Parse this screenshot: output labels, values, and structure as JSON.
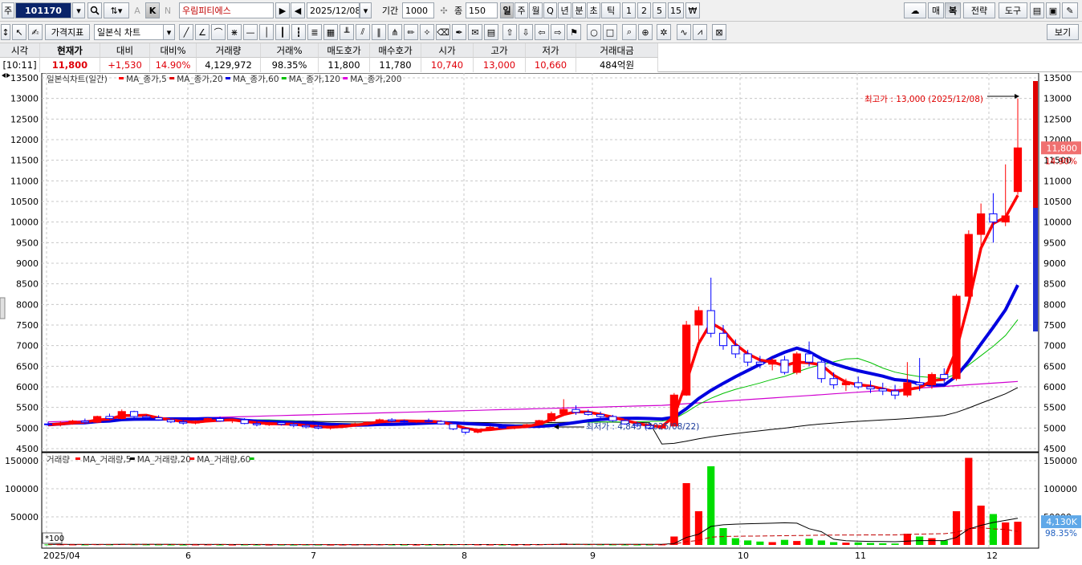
{
  "toolbar1": {
    "type_label": "주",
    "code_value": "101170",
    "stock_name": "우림피티에스",
    "date_value": "2025/12/08",
    "period_label": "기간",
    "period_value": "1000",
    "count_label": "종",
    "count_value": "150",
    "k_label": "K",
    "n_label": "N",
    "a_label": "A",
    "timeframes": [
      "일",
      "주",
      "월",
      "Q",
      "년",
      "분",
      "초",
      "틱",
      "1",
      "2",
      "5",
      "15"
    ],
    "active_timeframe": "일",
    "right_buttons": [
      "매",
      "복",
      "전략",
      "도구"
    ]
  },
  "toolbar2": {
    "indicator_button": "가격지표",
    "chart_type_value": "일본식 차트",
    "view_button": "보기"
  },
  "quote": {
    "headers": [
      "시각",
      "현재가",
      "대비",
      "대비%",
      "거래량",
      "거래%",
      "매도호가",
      "매수호가",
      "시가",
      "고가",
      "저가",
      "거래대금"
    ],
    "values": [
      "[10:11]",
      "11,800",
      "+1,530",
      "14.90%",
      "4,129,972",
      "98.35%",
      "11,800",
      "11,780",
      "10,740",
      "13,000",
      "10,660",
      "484억원"
    ]
  },
  "price_legend": {
    "title": "일본식차트(일간)",
    "items": [
      {
        "label": "MA_종가,5",
        "color": "#ff0000"
      },
      {
        "label": "MA_종가,20",
        "color": "#e00000"
      },
      {
        "label": "MA_종가,60",
        "color": "#0000e0"
      },
      {
        "label": "MA_종가,120",
        "color": "#00c000"
      },
      {
        "label": "MA_종가,200",
        "color": "#e000e0"
      }
    ]
  },
  "volume_legend": {
    "title": "거래량",
    "items": [
      {
        "label": "MA_거래량,5",
        "color": "#ff0000"
      },
      {
        "label": "MA_거래량,20",
        "color": "#000000"
      },
      {
        "label": "MA_거래량,60",
        "color": "#ff0000"
      }
    ],
    "tail_color": "#00c000"
  },
  "annotations": {
    "high_label": "최고가 : 13,000 (2025/12/08)",
    "low_label": "최저가 : 4,845 (2025/08/22)",
    "current_price_tag": "11,800",
    "current_pct_tag": "14.90%",
    "volume_tag": "4,130K",
    "volume_pct_tag": "98.35%",
    "volume_unit": "*100"
  },
  "colors": {
    "up": "#ff0000",
    "down": "#0000ff",
    "ma5": "#ff0000",
    "ma20": "#0000e0",
    "ma60": "#00c000",
    "ma120": "#000000",
    "ma200": "#d000d0"
  },
  "chart_data": {
    "type": "candlestick",
    "price_axis": {
      "min": 4500,
      "max": 13500,
      "ticks": [
        4500,
        5000,
        5500,
        6000,
        6500,
        7000,
        7500,
        8000,
        8500,
        9000,
        9500,
        10000,
        10500,
        11000,
        11500,
        12000,
        12500,
        13000,
        13500
      ]
    },
    "volume_axis": {
      "min": 0,
      "max": 150000,
      "ticks": [
        50000,
        100000,
        150000
      ]
    },
    "x_ticks": [
      "2025/04",
      "6",
      "7",
      "8",
      "9",
      "10",
      "11",
      "12"
    ],
    "grid": true,
    "ohlc": [
      [
        5100,
        5150,
        5050,
        5080
      ],
      [
        5080,
        5160,
        5040,
        5120
      ],
      [
        5120,
        5200,
        5080,
        5170
      ],
      [
        5170,
        5230,
        5100,
        5140
      ],
      [
        5140,
        5300,
        5120,
        5280
      ],
      [
        5280,
        5350,
        5200,
        5230
      ],
      [
        5230,
        5450,
        5210,
        5400
      ],
      [
        5400,
        5420,
        5250,
        5280
      ],
      [
        5280,
        5320,
        5200,
        5250
      ],
      [
        5250,
        5310,
        5180,
        5200
      ],
      [
        5200,
        5260,
        5120,
        5150
      ],
      [
        5150,
        5200,
        5080,
        5120
      ],
      [
        5120,
        5190,
        5090,
        5160
      ],
      [
        5160,
        5250,
        5140,
        5230
      ],
      [
        5230,
        5280,
        5150,
        5170
      ],
      [
        5170,
        5230,
        5120,
        5200
      ],
      [
        5200,
        5240,
        5090,
        5110
      ],
      [
        5110,
        5160,
        5040,
        5080
      ],
      [
        5080,
        5150,
        5050,
        5130
      ],
      [
        5130,
        5170,
        5060,
        5090
      ],
      [
        5090,
        5140,
        5020,
        5060
      ],
      [
        5060,
        5110,
        4990,
        5030
      ],
      [
        5030,
        5080,
        4970,
        5000
      ],
      [
        5000,
        5060,
        4960,
        5040
      ],
      [
        5040,
        5090,
        5000,
        5070
      ],
      [
        5070,
        5130,
        5030,
        5100
      ],
      [
        5100,
        5160,
        5060,
        5140
      ],
      [
        5140,
        5230,
        5110,
        5200
      ],
      [
        5200,
        5240,
        5140,
        5170
      ],
      [
        5170,
        5210,
        5110,
        5150
      ],
      [
        5150,
        5200,
        5120,
        5180
      ],
      [
        5180,
        5230,
        5140,
        5160
      ],
      [
        5160,
        5190,
        5080,
        5100
      ],
      [
        5100,
        5140,
        4950,
        4980
      ],
      [
        4980,
        5010,
        4845,
        4900
      ],
      [
        4900,
        4980,
        4870,
        4960
      ],
      [
        4960,
        5050,
        4940,
        5020
      ],
      [
        5020,
        5060,
        4980,
        5000
      ],
      [
        5000,
        5050,
        4970,
        5030
      ],
      [
        5030,
        5100,
        5000,
        5080
      ],
      [
        5080,
        5200,
        5060,
        5180
      ],
      [
        5180,
        5400,
        5150,
        5350
      ],
      [
        5350,
        5700,
        5300,
        5450
      ],
      [
        5450,
        5550,
        5320,
        5380
      ],
      [
        5380,
        5450,
        5300,
        5330
      ],
      [
        5330,
        5400,
        5250,
        5280
      ],
      [
        5280,
        5320,
        5150,
        5180
      ],
      [
        5180,
        5220,
        5080,
        5100
      ],
      [
        5100,
        5150,
        5020,
        5060
      ],
      [
        5060,
        5120,
        4990,
        5000
      ],
      [
        5000,
        5100,
        4960,
        5050
      ],
      [
        5050,
        5850,
        5040,
        5800
      ],
      [
        5800,
        7600,
        5780,
        7500
      ],
      [
        7500,
        7950,
        7100,
        7850
      ],
      [
        7850,
        8650,
        7200,
        7300
      ],
      [
        7300,
        7500,
        6900,
        7000
      ],
      [
        7000,
        7150,
        6700,
        6800
      ],
      [
        6800,
        6900,
        6500,
        6600
      ],
      [
        6600,
        6750,
        6450,
        6550
      ],
      [
        6550,
        6700,
        6400,
        6650
      ],
      [
        6650,
        6750,
        6300,
        6350
      ],
      [
        6350,
        6850,
        6300,
        6800
      ],
      [
        6800,
        7100,
        6500,
        6600
      ],
      [
        6600,
        6700,
        6100,
        6200
      ],
      [
        6200,
        6350,
        5950,
        6050
      ],
      [
        6050,
        6200,
        5900,
        6100
      ],
      [
        6100,
        6250,
        5950,
        6000
      ],
      [
        6000,
        6150,
        5850,
        5950
      ],
      [
        5950,
        6100,
        5800,
        5900
      ],
      [
        5900,
        6050,
        5700,
        5800
      ],
      [
        5800,
        6600,
        5750,
        6100
      ],
      [
        6100,
        6700,
        5900,
        6050
      ],
      [
        6050,
        6350,
        5950,
        6300
      ],
      [
        6300,
        6450,
        6100,
        6200
      ],
      [
        6200,
        8250,
        6150,
        8200
      ],
      [
        8200,
        9800,
        8000,
        9700
      ],
      [
        9700,
        10450,
        9300,
        10200
      ],
      [
        10200,
        10700,
        9500,
        10000
      ],
      [
        10000,
        11400,
        9900,
        10150
      ],
      [
        10740,
        13000,
        10660,
        11800
      ]
    ],
    "volume": [
      900,
      1000,
      800,
      700,
      1200,
      900,
      1500,
      1100,
      800,
      700,
      600,
      500,
      700,
      800,
      600,
      500,
      700,
      600,
      500,
      600,
      500,
      700,
      600,
      500,
      600,
      700,
      800,
      900,
      700,
      600,
      500,
      600,
      700,
      900,
      1200,
      800,
      700,
      600,
      500,
      700,
      1000,
      1500,
      2500,
      1800,
      1200,
      900,
      800,
      700,
      600,
      700,
      800,
      15000,
      110000,
      60000,
      140000,
      30000,
      12000,
      8000,
      6000,
      5000,
      9000,
      7000,
      11000,
      8000,
      5000,
      4000,
      4500,
      3500,
      3000,
      2500,
      20000,
      15000,
      12000,
      8000,
      60000,
      155000,
      70000,
      55000,
      40000,
      41300
    ]
  }
}
